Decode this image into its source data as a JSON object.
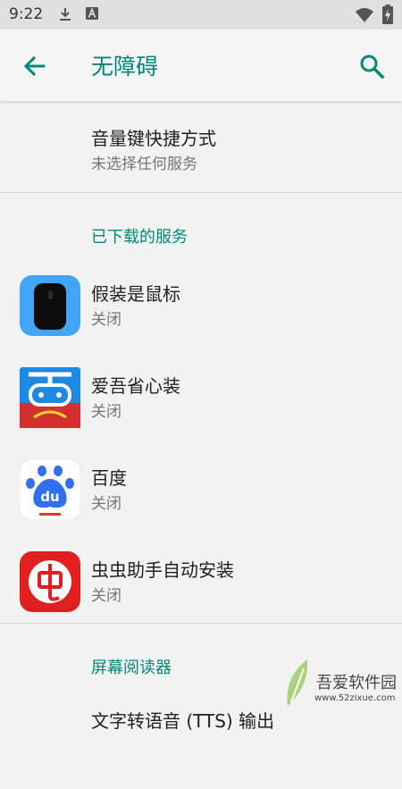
{
  "status_bar": {
    "time": "9:22"
  },
  "app_bar": {
    "title": "无障碍"
  },
  "volume_shortcut": {
    "title": "音量键快捷方式",
    "summary": "未选择任何服务"
  },
  "downloaded_header": "已下载的服务",
  "services": [
    {
      "title": "假装是鼠标",
      "summary": "关闭"
    },
    {
      "title": "爱吾省心装",
      "summary": "关闭"
    },
    {
      "title": "百度",
      "summary": "关闭"
    },
    {
      "title": "虫虫助手自动安装",
      "summary": "关闭"
    }
  ],
  "screen_reader_header": "屏幕阅读器",
  "partial_item": {
    "title": "文字转语音 (TTS) 输出"
  },
  "watermark": {
    "brand": "吾爱软件园",
    "url": "www.52zixue.com"
  },
  "colors": {
    "accent": "#00897b",
    "background": "#f2f2f2"
  }
}
